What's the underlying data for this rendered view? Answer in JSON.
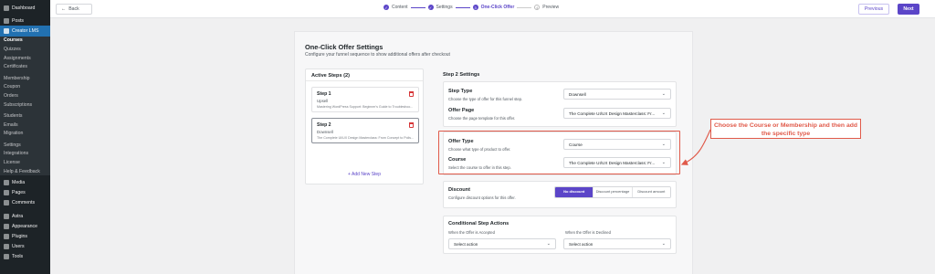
{
  "sidebar": {
    "items": [
      {
        "label": "Dashboard"
      },
      {
        "label": "Posts"
      },
      {
        "label": "Creator LMS"
      }
    ],
    "submenu": [
      {
        "label": "Courses"
      },
      {
        "label": "Quizzes"
      },
      {
        "label": "Assignments"
      },
      {
        "label": "Certificates"
      },
      {
        "label": "Membership"
      },
      {
        "label": "Coupon"
      },
      {
        "label": "Orders"
      },
      {
        "label": "Subscriptions"
      },
      {
        "label": "Students"
      },
      {
        "label": "Emails"
      },
      {
        "label": "Migration"
      },
      {
        "label": "Settings"
      },
      {
        "label": "Integrations"
      },
      {
        "label": "License"
      },
      {
        "label": "Help & Feedback"
      }
    ],
    "bottom_items": [
      {
        "label": "Media"
      },
      {
        "label": "Pages"
      },
      {
        "label": "Comments"
      },
      {
        "label": "Astra"
      },
      {
        "label": "Appearance"
      },
      {
        "label": "Plugins"
      },
      {
        "label": "Users"
      },
      {
        "label": "Tools"
      }
    ]
  },
  "topbar": {
    "back_label": "Back",
    "steps": [
      {
        "label": "Content",
        "num": "✓"
      },
      {
        "label": "Settings",
        "num": "✓"
      },
      {
        "label": "One-Click Offer",
        "num": "3"
      },
      {
        "label": "Preview",
        "num": "4"
      }
    ],
    "previous_label": "Previous",
    "next_label": "Next"
  },
  "panel": {
    "title": "One-Click Offer Settings",
    "subtitle": "Configure your funnel sequence to show additional offers after checkout",
    "active_steps": {
      "heading": "Active Steps (2)",
      "steps": [
        {
          "title": "Step 1",
          "type": "Upsell",
          "desc": "Mastering WordPress Support: Beginner's Guide to Troubleshoo..."
        },
        {
          "title": "Step 2",
          "type": "Downsell",
          "desc": "The Complete UI/UX Design Masterclass: From Concept to Polis..."
        }
      ],
      "add_label": "+ Add New Step"
    },
    "settings": {
      "heading": "Step 2 Settings",
      "step_type": {
        "title": "Step Type",
        "desc": "Choose the type of offer for this funnel step.",
        "value": "Downsell"
      },
      "offer_page": {
        "title": "Offer Page",
        "desc": "Choose the page template for this offer.",
        "value": "The Complete UI/UX Design Masterclass: Fr..."
      },
      "offer_type": {
        "title": "Offer Type",
        "desc": "Choose what type of product to offer.",
        "value": "Course"
      },
      "course": {
        "title": "Course",
        "desc": "Select the course to offer in this step.",
        "value": "The Complete UI/UX Design Masterclass: Fr..."
      },
      "discount": {
        "title": "Discount",
        "desc": "Configure discount options for this offer.",
        "options": [
          "No discount",
          "Discount percentage",
          "Discount amount"
        ]
      },
      "conditional": {
        "title": "Conditional Step Actions",
        "accepted_label": "When the Offer is Accepted",
        "accepted_value": "Select action",
        "declined_label": "When the Offer is Declined",
        "declined_value": "Select action"
      }
    }
  },
  "annotation": {
    "text": "Choose the Course or Membership and then add the specific type",
    "color": "#e05a4a"
  },
  "colors": {
    "accent": "#5b45c8",
    "wp_sidebar": "#1d2327",
    "wp_active": "#2271b1"
  }
}
